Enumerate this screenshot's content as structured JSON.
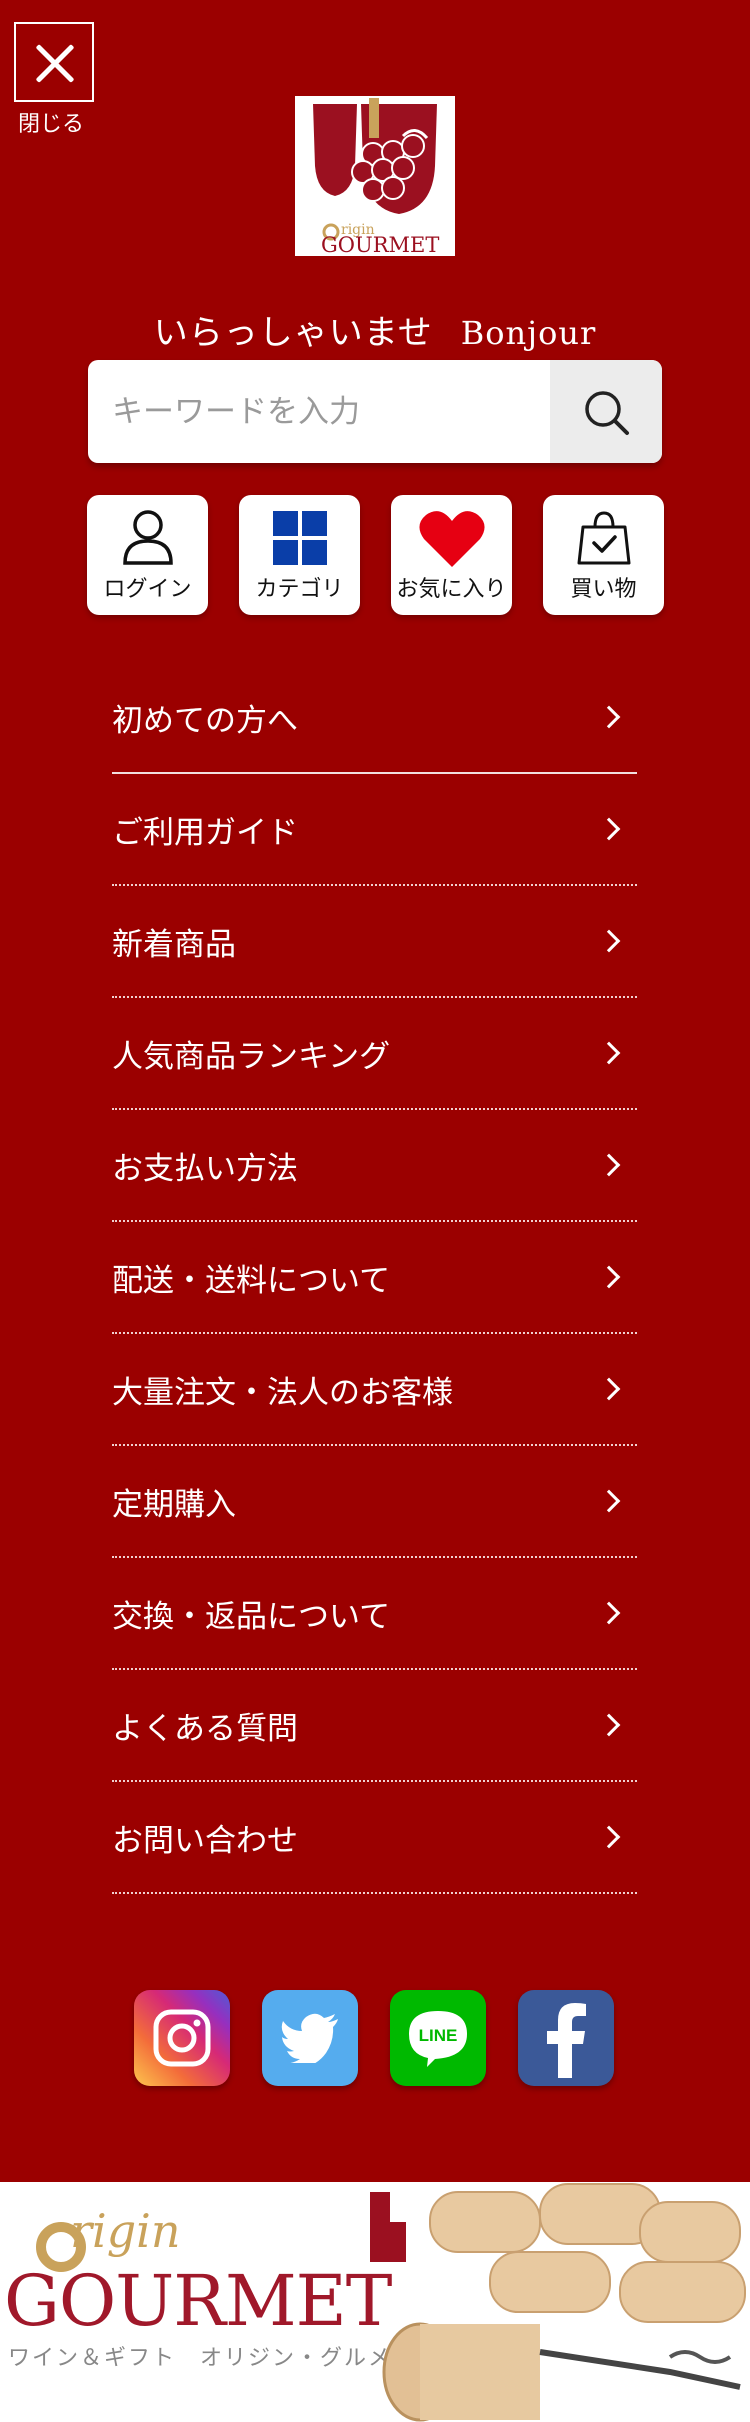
{
  "header": {
    "close_label": "閉じる"
  },
  "welcome": {
    "jp": "いらっしゃいませ",
    "fr": "Bonjour"
  },
  "search": {
    "placeholder": "キーワードを入力"
  },
  "quick_links": [
    {
      "label": "ログイン",
      "icon": "person-icon"
    },
    {
      "label": "カテゴリ",
      "icon": "grid-icon"
    },
    {
      "label": "お気に入り",
      "icon": "heart-icon"
    },
    {
      "label": "買い物",
      "icon": "shopping-bag-icon"
    }
  ],
  "menu": [
    {
      "label": "初めての方へ"
    },
    {
      "label": "ご利用ガイド"
    },
    {
      "label": "新着商品"
    },
    {
      "label": "人気商品ランキング"
    },
    {
      "label": "お支払い方法"
    },
    {
      "label": "配送・送料について"
    },
    {
      "label": "大量注文・法人のお客様"
    },
    {
      "label": "定期購入"
    },
    {
      "label": "交換・返品について"
    },
    {
      "label": "よくある質問"
    },
    {
      "label": "お問い合わせ"
    }
  ],
  "social": [
    {
      "name": "instagram-icon"
    },
    {
      "name": "twitter-icon"
    },
    {
      "name": "line-icon",
      "text": "LINE"
    },
    {
      "name": "facebook-icon"
    }
  ],
  "logo": {
    "small_brand": "GOURMET",
    "small_script": "rigin"
  },
  "banner": {
    "script": "rigin",
    "brand": "GOURMET",
    "tagline": "ワイン＆ギフト　オリジン・グルメ"
  },
  "colors": {
    "background": "#9b0000",
    "heart": "#e60012",
    "grid": "#0a3ea8",
    "line": "#00b900",
    "facebook": "#3b5998",
    "twitter": "#55acee"
  }
}
